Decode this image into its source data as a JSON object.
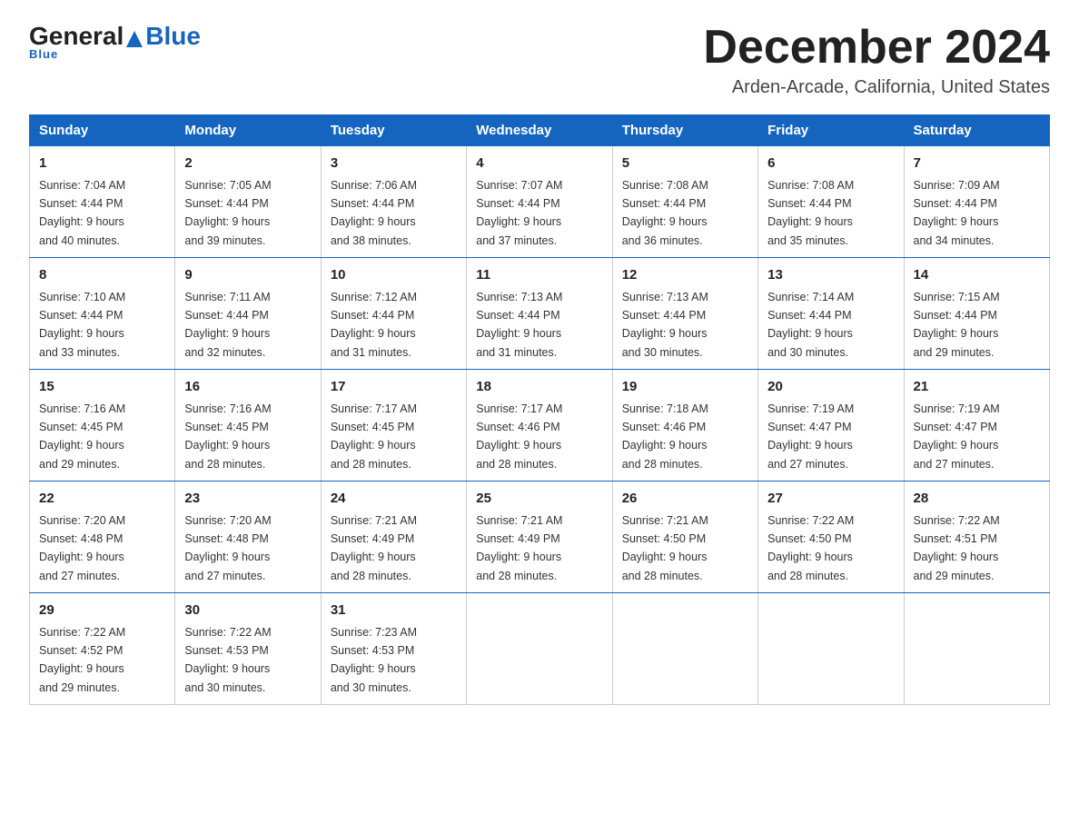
{
  "logo": {
    "general": "General",
    "blue": "Blue"
  },
  "title": "December 2024",
  "subtitle": "Arden-Arcade, California, United States",
  "days_of_week": [
    "Sunday",
    "Monday",
    "Tuesday",
    "Wednesday",
    "Thursday",
    "Friday",
    "Saturday"
  ],
  "weeks": [
    [
      {
        "day": "1",
        "sunrise": "7:04 AM",
        "sunset": "4:44 PM",
        "daylight": "9 hours and 40 minutes."
      },
      {
        "day": "2",
        "sunrise": "7:05 AM",
        "sunset": "4:44 PM",
        "daylight": "9 hours and 39 minutes."
      },
      {
        "day": "3",
        "sunrise": "7:06 AM",
        "sunset": "4:44 PM",
        "daylight": "9 hours and 38 minutes."
      },
      {
        "day": "4",
        "sunrise": "7:07 AM",
        "sunset": "4:44 PM",
        "daylight": "9 hours and 37 minutes."
      },
      {
        "day": "5",
        "sunrise": "7:08 AM",
        "sunset": "4:44 PM",
        "daylight": "9 hours and 36 minutes."
      },
      {
        "day": "6",
        "sunrise": "7:08 AM",
        "sunset": "4:44 PM",
        "daylight": "9 hours and 35 minutes."
      },
      {
        "day": "7",
        "sunrise": "7:09 AM",
        "sunset": "4:44 PM",
        "daylight": "9 hours and 34 minutes."
      }
    ],
    [
      {
        "day": "8",
        "sunrise": "7:10 AM",
        "sunset": "4:44 PM",
        "daylight": "9 hours and 33 minutes."
      },
      {
        "day": "9",
        "sunrise": "7:11 AM",
        "sunset": "4:44 PM",
        "daylight": "9 hours and 32 minutes."
      },
      {
        "day": "10",
        "sunrise": "7:12 AM",
        "sunset": "4:44 PM",
        "daylight": "9 hours and 31 minutes."
      },
      {
        "day": "11",
        "sunrise": "7:13 AM",
        "sunset": "4:44 PM",
        "daylight": "9 hours and 31 minutes."
      },
      {
        "day": "12",
        "sunrise": "7:13 AM",
        "sunset": "4:44 PM",
        "daylight": "9 hours and 30 minutes."
      },
      {
        "day": "13",
        "sunrise": "7:14 AM",
        "sunset": "4:44 PM",
        "daylight": "9 hours and 30 minutes."
      },
      {
        "day": "14",
        "sunrise": "7:15 AM",
        "sunset": "4:44 PM",
        "daylight": "9 hours and 29 minutes."
      }
    ],
    [
      {
        "day": "15",
        "sunrise": "7:16 AM",
        "sunset": "4:45 PM",
        "daylight": "9 hours and 29 minutes."
      },
      {
        "day": "16",
        "sunrise": "7:16 AM",
        "sunset": "4:45 PM",
        "daylight": "9 hours and 28 minutes."
      },
      {
        "day": "17",
        "sunrise": "7:17 AM",
        "sunset": "4:45 PM",
        "daylight": "9 hours and 28 minutes."
      },
      {
        "day": "18",
        "sunrise": "7:17 AM",
        "sunset": "4:46 PM",
        "daylight": "9 hours and 28 minutes."
      },
      {
        "day": "19",
        "sunrise": "7:18 AM",
        "sunset": "4:46 PM",
        "daylight": "9 hours and 28 minutes."
      },
      {
        "day": "20",
        "sunrise": "7:19 AM",
        "sunset": "4:47 PM",
        "daylight": "9 hours and 27 minutes."
      },
      {
        "day": "21",
        "sunrise": "7:19 AM",
        "sunset": "4:47 PM",
        "daylight": "9 hours and 27 minutes."
      }
    ],
    [
      {
        "day": "22",
        "sunrise": "7:20 AM",
        "sunset": "4:48 PM",
        "daylight": "9 hours and 27 minutes."
      },
      {
        "day": "23",
        "sunrise": "7:20 AM",
        "sunset": "4:48 PM",
        "daylight": "9 hours and 27 minutes."
      },
      {
        "day": "24",
        "sunrise": "7:21 AM",
        "sunset": "4:49 PM",
        "daylight": "9 hours and 28 minutes."
      },
      {
        "day": "25",
        "sunrise": "7:21 AM",
        "sunset": "4:49 PM",
        "daylight": "9 hours and 28 minutes."
      },
      {
        "day": "26",
        "sunrise": "7:21 AM",
        "sunset": "4:50 PM",
        "daylight": "9 hours and 28 minutes."
      },
      {
        "day": "27",
        "sunrise": "7:22 AM",
        "sunset": "4:50 PM",
        "daylight": "9 hours and 28 minutes."
      },
      {
        "day": "28",
        "sunrise": "7:22 AM",
        "sunset": "4:51 PM",
        "daylight": "9 hours and 29 minutes."
      }
    ],
    [
      {
        "day": "29",
        "sunrise": "7:22 AM",
        "sunset": "4:52 PM",
        "daylight": "9 hours and 29 minutes."
      },
      {
        "day": "30",
        "sunrise": "7:22 AM",
        "sunset": "4:53 PM",
        "daylight": "9 hours and 30 minutes."
      },
      {
        "day": "31",
        "sunrise": "7:23 AM",
        "sunset": "4:53 PM",
        "daylight": "9 hours and 30 minutes."
      },
      null,
      null,
      null,
      null
    ]
  ],
  "labels": {
    "sunrise": "Sunrise:",
    "sunset": "Sunset:",
    "daylight": "Daylight:"
  }
}
